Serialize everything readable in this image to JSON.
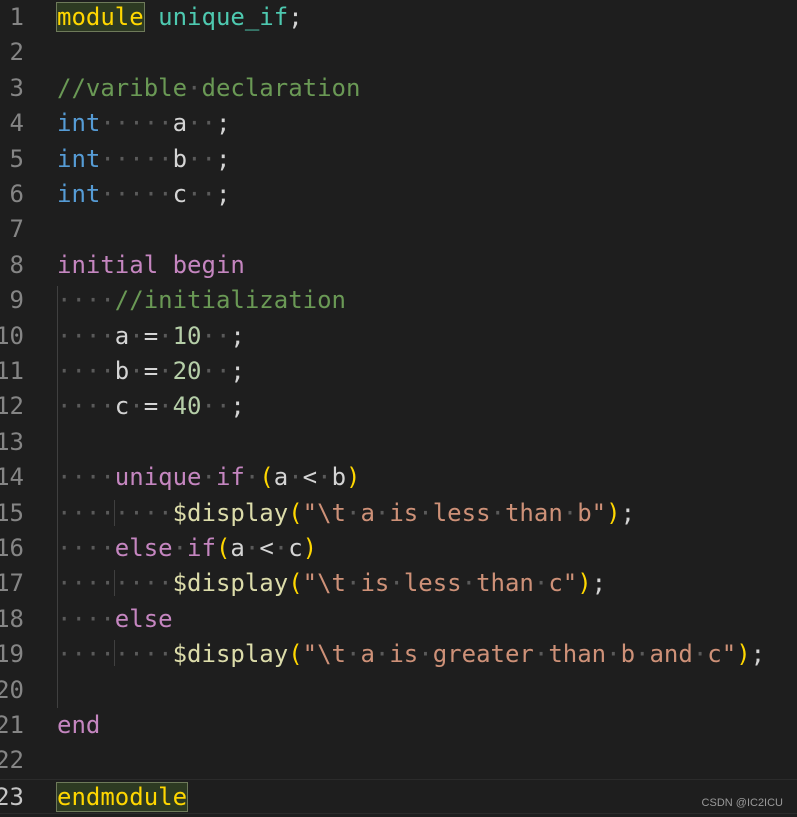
{
  "editor": {
    "active_line": 23,
    "lines": [
      {
        "n": "1",
        "tokens": [
          [
            "module",
            "kw-mod box"
          ],
          [
            " ",
            "ws"
          ],
          [
            "unique_if",
            "name"
          ],
          [
            ";",
            ""
          ]
        ]
      },
      {
        "n": "2",
        "tokens": []
      },
      {
        "n": "3",
        "tokens": [
          [
            "//varible",
            "cmt"
          ],
          [
            "·",
            "ws"
          ],
          [
            "declaration",
            "cmt"
          ]
        ]
      },
      {
        "n": "4",
        "tokens": [
          [
            "int",
            "type"
          ],
          [
            "·····",
            "ws"
          ],
          [
            "a",
            ""
          ],
          [
            "··",
            "ws"
          ],
          [
            ";",
            ""
          ]
        ]
      },
      {
        "n": "5",
        "tokens": [
          [
            "int",
            "type"
          ],
          [
            "·····",
            "ws"
          ],
          [
            "b",
            ""
          ],
          [
            "··",
            "ws"
          ],
          [
            ";",
            ""
          ]
        ]
      },
      {
        "n": "6",
        "tokens": [
          [
            "int",
            "type"
          ],
          [
            "·····",
            "ws"
          ],
          [
            "c",
            ""
          ],
          [
            "··",
            "ws"
          ],
          [
            ";",
            ""
          ]
        ]
      },
      {
        "n": "7",
        "tokens": []
      },
      {
        "n": "8",
        "tokens": [
          [
            "initial",
            "ctrl"
          ],
          [
            " ",
            "ws"
          ],
          [
            "begin",
            "ctrl"
          ]
        ]
      },
      {
        "n": "9",
        "tokens": [
          [
            "····",
            "ws"
          ],
          [
            "//initialization",
            "cmt"
          ]
        ]
      },
      {
        "n": "10",
        "tokens": [
          [
            "····",
            "ws"
          ],
          [
            "a",
            ""
          ],
          [
            "·",
            "ws"
          ],
          [
            "=",
            ""
          ],
          [
            "·",
            "ws"
          ],
          [
            "10",
            "num"
          ],
          [
            "··",
            "ws"
          ],
          [
            ";",
            ""
          ]
        ]
      },
      {
        "n": "11",
        "tokens": [
          [
            "····",
            "ws"
          ],
          [
            "b",
            ""
          ],
          [
            "·",
            "ws"
          ],
          [
            "=",
            ""
          ],
          [
            "·",
            "ws"
          ],
          [
            "20",
            "num"
          ],
          [
            "··",
            "ws"
          ],
          [
            ";",
            ""
          ]
        ]
      },
      {
        "n": "12",
        "tokens": [
          [
            "····",
            "ws"
          ],
          [
            "c",
            ""
          ],
          [
            "·",
            "ws"
          ],
          [
            "=",
            ""
          ],
          [
            "·",
            "ws"
          ],
          [
            "40",
            "num"
          ],
          [
            "··",
            "ws"
          ],
          [
            ";",
            ""
          ]
        ]
      },
      {
        "n": "13",
        "tokens": []
      },
      {
        "n": "14",
        "tokens": [
          [
            "····",
            "ws"
          ],
          [
            "unique",
            "ctrl"
          ],
          [
            "·",
            "ws"
          ],
          [
            "if",
            "ctrl"
          ],
          [
            "·",
            "ws"
          ],
          [
            "(",
            "br1"
          ],
          [
            "a",
            ""
          ],
          [
            "·",
            "ws"
          ],
          [
            "<",
            ""
          ],
          [
            "·",
            "ws"
          ],
          [
            "b",
            ""
          ],
          [
            ")",
            "br1"
          ]
        ]
      },
      {
        "n": "15",
        "tokens": [
          [
            "········",
            "ws"
          ],
          [
            "$display",
            "fn"
          ],
          [
            "(",
            "br1"
          ],
          [
            "\"\\t",
            "str"
          ],
          [
            "·",
            "ws"
          ],
          [
            "a",
            "str"
          ],
          [
            "·",
            "ws"
          ],
          [
            "is",
            "str"
          ],
          [
            "·",
            "ws"
          ],
          [
            "less",
            "str"
          ],
          [
            "·",
            "ws"
          ],
          [
            "than",
            "str"
          ],
          [
            "·",
            "ws"
          ],
          [
            "b\"",
            "str"
          ],
          [
            ")",
            "br1"
          ],
          [
            ";",
            ""
          ]
        ]
      },
      {
        "n": "16",
        "tokens": [
          [
            "····",
            "ws"
          ],
          [
            "else",
            "ctrl"
          ],
          [
            "·",
            "ws"
          ],
          [
            "if",
            "ctrl"
          ],
          [
            "(",
            "br1"
          ],
          [
            "a",
            ""
          ],
          [
            "·",
            "ws"
          ],
          [
            "<",
            ""
          ],
          [
            "·",
            "ws"
          ],
          [
            "c",
            ""
          ],
          [
            ")",
            "br1"
          ]
        ]
      },
      {
        "n": "17",
        "tokens": [
          [
            "········",
            "ws"
          ],
          [
            "$display",
            "fn"
          ],
          [
            "(",
            "br1"
          ],
          [
            "\"\\t",
            "str"
          ],
          [
            "·",
            "ws"
          ],
          [
            "is",
            "str"
          ],
          [
            "·",
            "ws"
          ],
          [
            "less",
            "str"
          ],
          [
            "·",
            "ws"
          ],
          [
            "than",
            "str"
          ],
          [
            "·",
            "ws"
          ],
          [
            "c\"",
            "str"
          ],
          [
            ")",
            "br1"
          ],
          [
            ";",
            ""
          ]
        ]
      },
      {
        "n": "18",
        "tokens": [
          [
            "····",
            "ws"
          ],
          [
            "else",
            "ctrl"
          ]
        ]
      },
      {
        "n": "19",
        "tokens": [
          [
            "········",
            "ws"
          ],
          [
            "$display",
            "fn"
          ],
          [
            "(",
            "br1"
          ],
          [
            "\"\\t",
            "str"
          ],
          [
            "·",
            "ws"
          ],
          [
            "a",
            "str"
          ],
          [
            "·",
            "ws"
          ],
          [
            "is",
            "str"
          ],
          [
            "·",
            "ws"
          ],
          [
            "greater",
            "str"
          ],
          [
            "·",
            "ws"
          ],
          [
            "than",
            "str"
          ],
          [
            "·",
            "ws"
          ],
          [
            "b",
            "str"
          ],
          [
            "·",
            "ws"
          ],
          [
            "and",
            "str"
          ],
          [
            "·",
            "ws"
          ],
          [
            "c\"",
            "str"
          ],
          [
            ")",
            "br1"
          ],
          [
            ";",
            ""
          ]
        ]
      },
      {
        "n": "20",
        "tokens": []
      },
      {
        "n": "21",
        "tokens": [
          [
            "end",
            "ctrl"
          ]
        ]
      },
      {
        "n": "22",
        "tokens": []
      },
      {
        "n": "23",
        "tokens": [
          [
            "endmodule",
            "kw-mod box"
          ]
        ]
      }
    ]
  },
  "watermark": "CSDN @IC2ICU"
}
